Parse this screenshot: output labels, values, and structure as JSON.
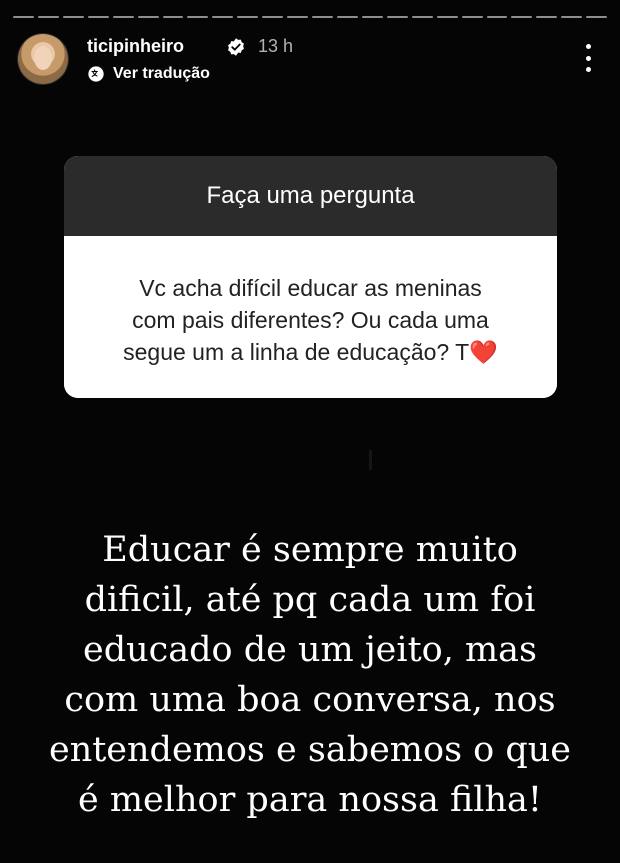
{
  "header": {
    "username": "ticipinheiro",
    "time": "13 h",
    "translate_label": "Ver tradução"
  },
  "question_card": {
    "title": "Faça uma pergunta",
    "question_lines": [
      "Vc acha difícil educar as meninas",
      "com pais diferentes? Ou cada uma",
      "segue um a linha de educação? T"
    ],
    "question_emoji": "❤️"
  },
  "answer": {
    "lines": [
      "Educar é sempre muito",
      "dificil, até pq cada um foi",
      "educado de um jeito, mas",
      "com uma boa conversa, nos",
      "entendemos e sabemos o que",
      "é melhor para nossa filha!"
    ]
  },
  "colors": {
    "background": "#050505",
    "card_header": "#2b2b2b",
    "heart": "#e21b2a",
    "verified": "#ffffff"
  },
  "icons": {
    "verified": "verified-badge-icon",
    "translate": "translate-icon",
    "more": "more-options-icon"
  }
}
